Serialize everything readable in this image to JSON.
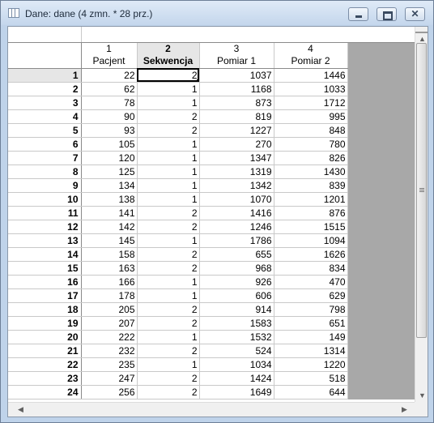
{
  "window": {
    "title": "Dane: dane (4 zmn. * 28 prz.)",
    "buttons": {
      "minimize": "minimize",
      "maximize": "maximize",
      "close": "✕"
    }
  },
  "columns": [
    {
      "number": "1",
      "name": "Pacjent"
    },
    {
      "number": "2",
      "name": "Sekwencja"
    },
    {
      "number": "3",
      "name": "Pomiar 1"
    },
    {
      "number": "4",
      "name": "Pomiar 2"
    }
  ],
  "selection": {
    "row": "1",
    "column": "2"
  },
  "rows": [
    [
      "1",
      "22",
      "2",
      "1037",
      "1446"
    ],
    [
      "2",
      "62",
      "1",
      "1168",
      "1033"
    ],
    [
      "3",
      "78",
      "1",
      "873",
      "1712"
    ],
    [
      "4",
      "90",
      "2",
      "819",
      "995"
    ],
    [
      "5",
      "93",
      "2",
      "1227",
      "848"
    ],
    [
      "6",
      "105",
      "1",
      "270",
      "780"
    ],
    [
      "7",
      "120",
      "1",
      "1347",
      "826"
    ],
    [
      "8",
      "125",
      "1",
      "1319",
      "1430"
    ],
    [
      "9",
      "134",
      "1",
      "1342",
      "839"
    ],
    [
      "10",
      "138",
      "1",
      "1070",
      "1201"
    ],
    [
      "11",
      "141",
      "2",
      "1416",
      "876"
    ],
    [
      "12",
      "142",
      "2",
      "1246",
      "1515"
    ],
    [
      "13",
      "145",
      "1",
      "1786",
      "1094"
    ],
    [
      "14",
      "158",
      "2",
      "655",
      "1626"
    ],
    [
      "15",
      "163",
      "2",
      "968",
      "834"
    ],
    [
      "16",
      "166",
      "1",
      "926",
      "470"
    ],
    [
      "17",
      "178",
      "1",
      "606",
      "629"
    ],
    [
      "18",
      "205",
      "2",
      "914",
      "798"
    ],
    [
      "19",
      "207",
      "2",
      "1583",
      "651"
    ],
    [
      "20",
      "222",
      "1",
      "1532",
      "149"
    ],
    [
      "21",
      "232",
      "2",
      "524",
      "1314"
    ],
    [
      "22",
      "235",
      "1",
      "1034",
      "1220"
    ],
    [
      "23",
      "247",
      "2",
      "1424",
      "518"
    ],
    [
      "24",
      "256",
      "2",
      "1649",
      "644"
    ]
  ]
}
